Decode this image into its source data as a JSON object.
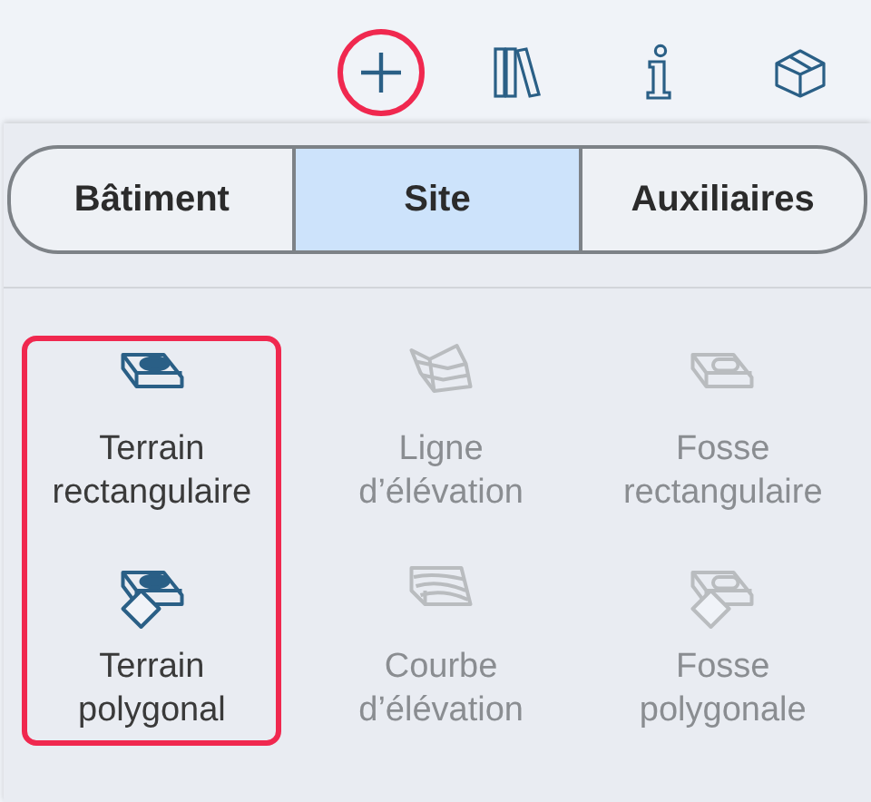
{
  "toolbar": [
    {
      "kind": "add",
      "highlighted": true
    },
    {
      "kind": "library",
      "highlighted": false
    },
    {
      "kind": "info",
      "highlighted": false
    },
    {
      "kind": "house",
      "highlighted": false
    }
  ],
  "tabs": [
    {
      "label": "Bâtiment",
      "selected": false
    },
    {
      "label": "Site",
      "selected": true
    },
    {
      "label": "Auxiliaires",
      "selected": false
    }
  ],
  "tool_columns": [
    {
      "highlighted": true,
      "tools": [
        {
          "kind": "terrain-rect",
          "label": "Terrain rectangulaire",
          "disabled": false
        },
        {
          "kind": "terrain-poly",
          "label": "Terrain polygonal",
          "disabled": false
        }
      ]
    },
    {
      "highlighted": false,
      "tools": [
        {
          "kind": "line-elev",
          "label": "Ligne d’élévation",
          "disabled": true
        },
        {
          "kind": "curve-elev",
          "label": "Courbe d’élévation",
          "disabled": true
        }
      ]
    },
    {
      "highlighted": false,
      "tools": [
        {
          "kind": "pit-rect",
          "label": "Fosse rectangulaire",
          "disabled": true
        },
        {
          "kind": "pit-poly",
          "label": "Fosse polygonale",
          "disabled": true
        }
      ]
    }
  ]
}
